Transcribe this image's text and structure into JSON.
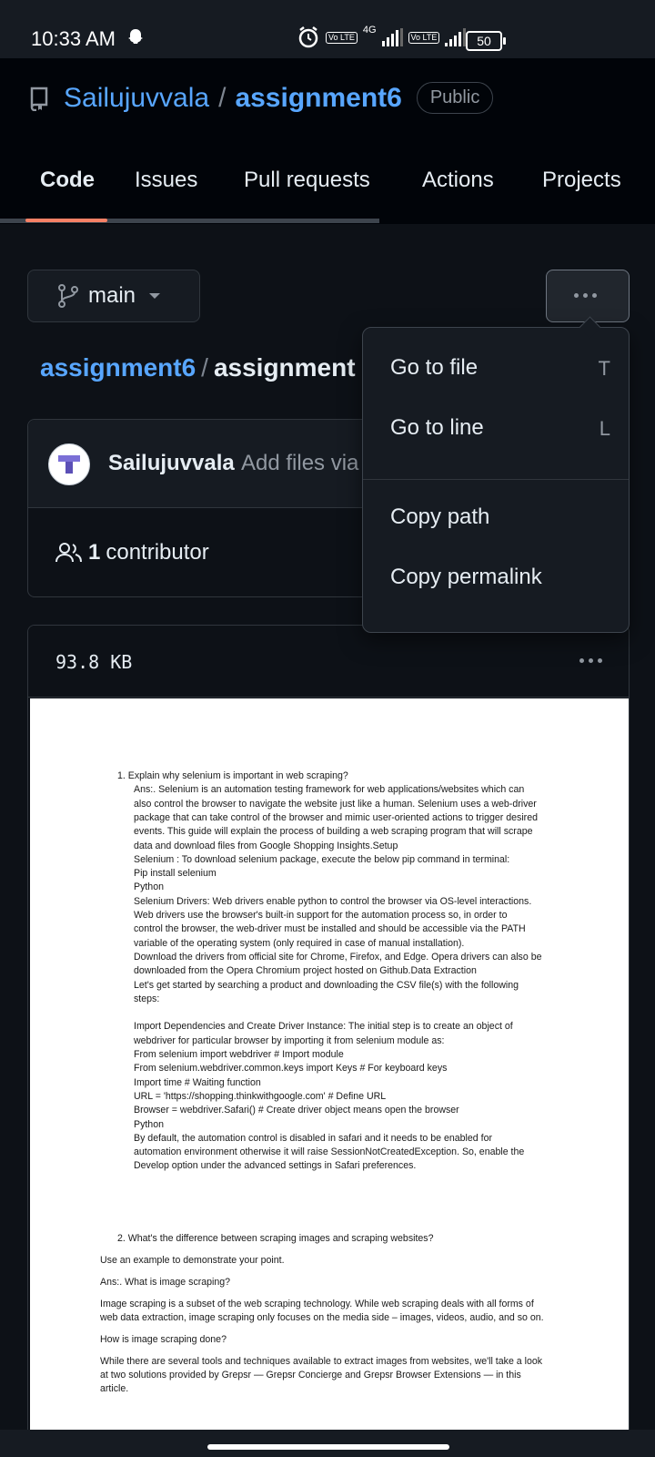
{
  "status": {
    "time": "10:33 AM",
    "network": "4G",
    "volte": "Vo LTE",
    "battery": "50"
  },
  "repo": {
    "owner": "Sailujuvvala",
    "separator": "/",
    "name": "assignment6",
    "visibility": "Public"
  },
  "tabs": [
    "Code",
    "Issues",
    "Pull requests",
    "Actions",
    "Projects"
  ],
  "branch": {
    "name": "main"
  },
  "breadcrumb": {
    "root": "assignment6",
    "separator": "/",
    "file": "assignment"
  },
  "commit": {
    "author": "Sailujuvvala",
    "message": "Add files via"
  },
  "contributors": {
    "count": "1",
    "label": "contributor"
  },
  "file": {
    "size": "93.8 KB"
  },
  "menu": {
    "go_to_file": "Go to file",
    "go_to_file_key": "T",
    "go_to_line": "Go to line",
    "go_to_line_key": "L",
    "copy_path": "Copy path",
    "copy_permalink": "Copy permalink"
  },
  "document": {
    "lines": [
      "1.   Explain why selenium is important in web scraping?",
      "Ans:.    Selenium is an automation testing framework for web applications/websites which can",
      "also control the browser to navigate the website just like a human. Selenium uses a web-driver",
      "package that can take control of the browser and mimic user-oriented actions to trigger desired",
      "events. This guide will explain the process of building a web scraping program that will scrape",
      "data and download files from Google Shopping Insights.Setup",
      "Selenium : To download selenium package, execute the below pip command in terminal:",
      "Pip install selenium",
      "Python",
      "Selenium Drivers: Web drivers enable python to control the browser via OS-level interactions.",
      "Web drivers use the browser's built-in support for the automation process so, in order to",
      "control the browser, the web-driver must be installed and should be accessible via the PATH",
      "variable of the operating system (only required in case of manual installation).",
      "Download the drivers from official site for Chrome, Firefox, and Edge. Opera drivers can also be",
      "downloaded from the Opera Chromium project hosted on Github.Data Extraction",
      "Let's get started by searching a product and downloading the CSV file(s) with the following",
      "steps:",
      "",
      "Import Dependencies and Create Driver Instance: The initial step is to create an object of",
      "webdriver for particular browser by importing it from selenium module as:",
      "From selenium import webdriver                    # Import module",
      "From selenium.webdriver.common.keys import Keys   # For keyboard keys",
      "Import time                                       # Waiting function",
      "URL = 'https://shopping.thinkwithgoogle.com'      # Define URL",
      "Browser = webdriver.Safari()                      # Create driver object means open the browser",
      "Python",
      "By default, the automation control is disabled in safari and it needs to be enabled for",
      "automation environment otherwise it will raise SessionNotCreatedException. So, enable the",
      "Develop option under the advanced settings in Safari preferences."
    ],
    "q2": "2.   What's the difference between scraping images and scraping websites?",
    "q2_sub": "Use an example to demonstrate your point.",
    "q2_ans": "Ans:.     What is image scraping?",
    "p1a": "Image scraping is a subset of the web scraping technology. While web scraping deals with all forms of",
    "p1b": "web data extraction, image scraping only focuses on the media side – images, videos, audio, and so on.",
    "q_how": "How is image scraping done?",
    "p2a": "While there are several tools and techniques available to extract images from websites, we'll take a look",
    "p2b": "at two solutions provided by Grepsr — Grepsr Concierge and Grepsr Browser Extensions — in this",
    "p2c": "article."
  }
}
